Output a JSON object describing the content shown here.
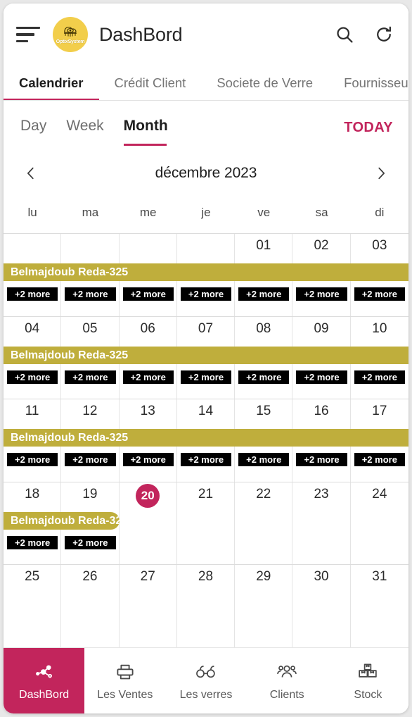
{
  "header": {
    "menu_icon": "hamburger-menu-icon",
    "logo_text": "OptixSystem",
    "title": "DashBord",
    "search_icon": "search-icon",
    "refresh_icon": "refresh-icon"
  },
  "tabs": [
    {
      "label": "Calendrier",
      "active": true
    },
    {
      "label": "Crédit Client",
      "active": false
    },
    {
      "label": "Societe de Verre",
      "active": false
    },
    {
      "label": "Fournisseu",
      "active": false
    }
  ],
  "view_selector": {
    "options": [
      {
        "label": "Day",
        "active": false
      },
      {
        "label": "Week",
        "active": false
      },
      {
        "label": "Month",
        "active": true
      }
    ],
    "today_label": "TODAY"
  },
  "month_nav": {
    "prev_icon": "chevron-left-icon",
    "next_icon": "chevron-right-icon",
    "label": "décembre 2023"
  },
  "calendar": {
    "day_headers": [
      "lu",
      "ma",
      "me",
      "je",
      "ve",
      "sa",
      "di"
    ],
    "event_label": "Belmajdoub Reda-325",
    "more_label": "+2 more",
    "accent_color": "#C2255C",
    "event_color": "#BFAE3C",
    "weeks": [
      {
        "days": [
          "",
          "",
          "",
          "",
          "01",
          "02",
          "03"
        ],
        "today_index": -1,
        "event_start": 0,
        "event_span": 7,
        "more_cells": [
          true,
          true,
          true,
          true,
          true,
          true,
          true
        ]
      },
      {
        "days": [
          "04",
          "05",
          "06",
          "07",
          "08",
          "09",
          "10"
        ],
        "today_index": -1,
        "event_start": 0,
        "event_span": 7,
        "more_cells": [
          true,
          true,
          true,
          true,
          true,
          true,
          true
        ]
      },
      {
        "days": [
          "11",
          "12",
          "13",
          "14",
          "15",
          "16",
          "17"
        ],
        "today_index": -1,
        "event_start": 0,
        "event_span": 7,
        "more_cells": [
          true,
          true,
          true,
          true,
          true,
          true,
          true
        ]
      },
      {
        "days": [
          "18",
          "19",
          "20",
          "21",
          "22",
          "23",
          "24"
        ],
        "today_index": 2,
        "event_start": 0,
        "event_span": 2,
        "more_cells": [
          true,
          true,
          false,
          false,
          false,
          false,
          false
        ]
      },
      {
        "days": [
          "25",
          "26",
          "27",
          "28",
          "29",
          "30",
          "31"
        ],
        "today_index": -1,
        "event_start": -1,
        "event_span": 0,
        "more_cells": [
          false,
          false,
          false,
          false,
          false,
          false,
          false
        ]
      }
    ]
  },
  "bottom_nav": [
    {
      "label": "DashBord",
      "icon": "network-nodes-icon",
      "active": true
    },
    {
      "label": "Les Ventes",
      "icon": "printer-icon",
      "active": false
    },
    {
      "label": "Les verres",
      "icon": "eyeglasses-icon",
      "active": false
    },
    {
      "label": "Clients",
      "icon": "people-group-icon",
      "active": false
    },
    {
      "label": "Stock",
      "icon": "boxes-icon",
      "active": false
    }
  ]
}
